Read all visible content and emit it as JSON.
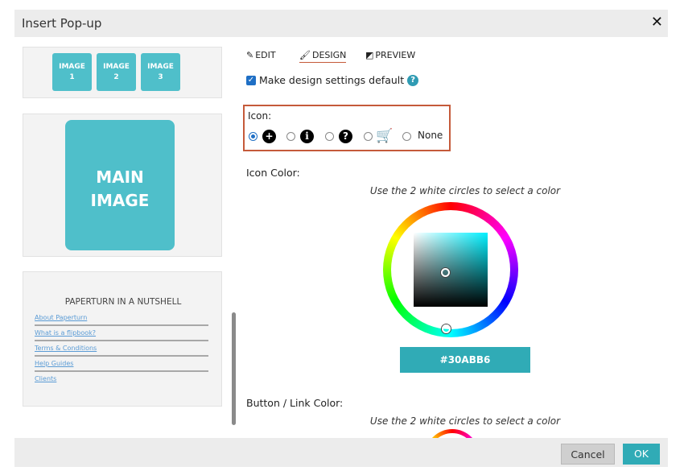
{
  "dialog": {
    "title": "Insert Pop-up",
    "close_glyph": "✕"
  },
  "left": {
    "thumbnails": [
      {
        "line1": "IMAGE",
        "line2": "1"
      },
      {
        "line1": "IMAGE",
        "line2": "2"
      },
      {
        "line1": "IMAGE",
        "line2": "3"
      }
    ],
    "main_image": {
      "line1": "MAIN",
      "line2": "IMAGE"
    },
    "links_title": "PAPERTURN IN A NUTSHELL",
    "links": [
      "About Paperturn",
      "What is a flipbook?",
      "Terms & Conditions",
      "Help Guides",
      "Clients"
    ]
  },
  "tabs": [
    {
      "label": "EDIT",
      "icon": "pencil-icon"
    },
    {
      "label": "DESIGN",
      "icon": "brush-icon"
    },
    {
      "label": "PREVIEW",
      "icon": "preview-icon"
    }
  ],
  "design": {
    "default_label": "Make design settings default",
    "default_checked": true,
    "icon_label": "Icon:",
    "icon_options": [
      "plus-circle-icon",
      "info-circle-icon",
      "question-circle-icon",
      "cart-icon",
      "None"
    ],
    "icon_none_label": "None",
    "icon_selected": "plus-circle-icon",
    "icon_color_label": "Icon Color:",
    "hint": "Use the 2 white circles to select a color",
    "icon_color_hex": "#30ABB6",
    "button_color_label": "Button / Link Color:",
    "hint2": "Use the 2 white circles to select a color"
  },
  "footer": {
    "cancel_label": "Cancel",
    "ok_label": "OK"
  },
  "colors": {
    "accent": "#30abb6",
    "thumb": "#4fbfca",
    "highlight": "#c55a3a",
    "checkbox": "#1f6fc5"
  }
}
